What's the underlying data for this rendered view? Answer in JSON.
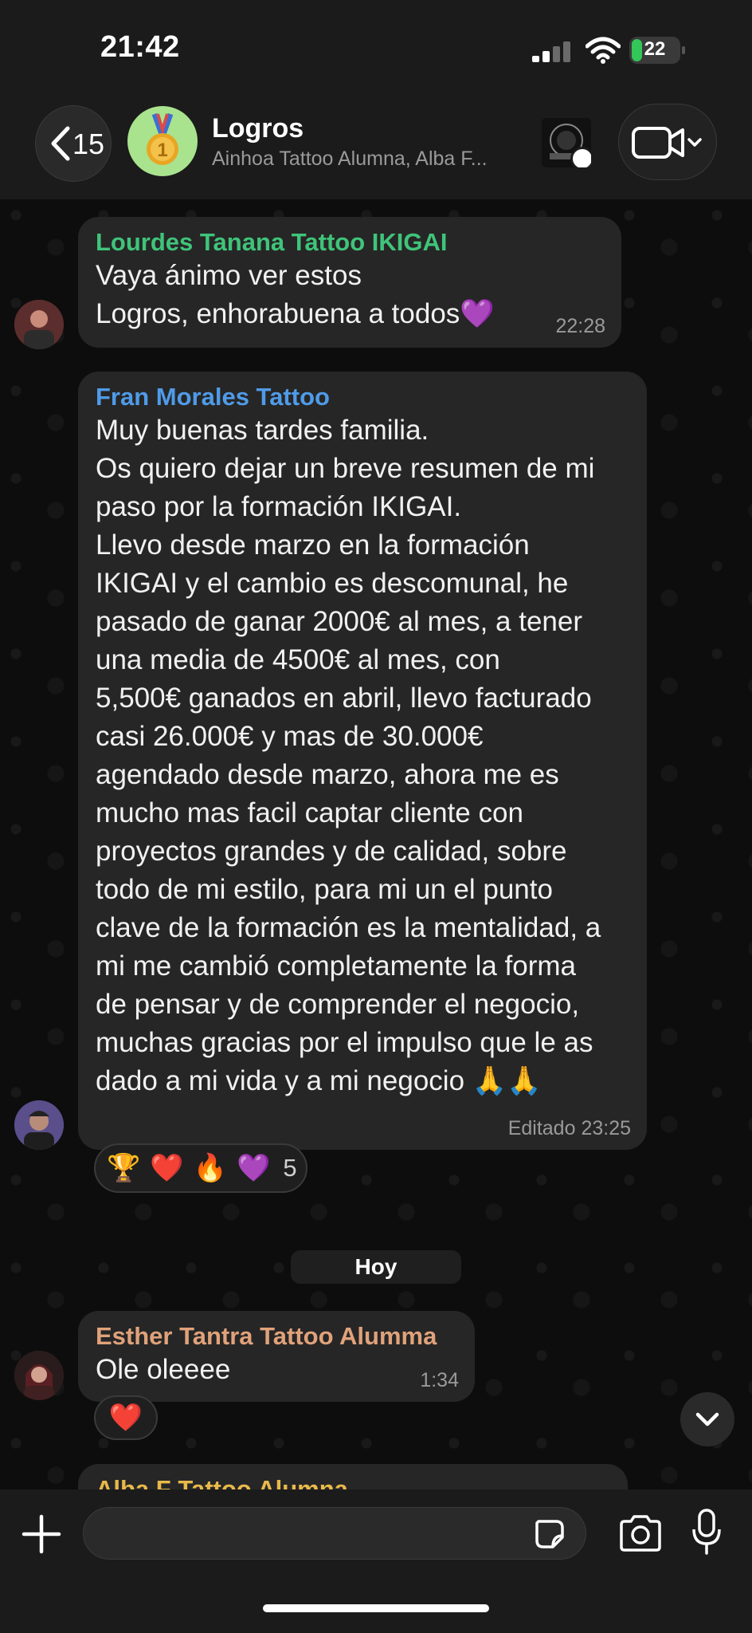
{
  "status_bar": {
    "time": "21:42",
    "battery": "22",
    "battery_level": 0.22
  },
  "header": {
    "back_count": "15",
    "title": "Logros",
    "subtitle": "Ainhoa Tattoo Alumna, Alba F..."
  },
  "messages": [
    {
      "sender": "Lourdes Tanana Tattoo IKIGAI",
      "sender_color": "#3fc47a",
      "text": "Vaya ánimo ver estos\nLogros, enhorabuena a todos💜",
      "time": "22:28"
    },
    {
      "sender": "Fran Morales Tattoo",
      "sender_color": "#4f9be8",
      "text": "Muy buenas tardes familia.\nOs quiero dejar un breve resumen de mi\npaso por la formación IKIGAI.\nLlevo desde marzo en la formación\nIKIGAI y el cambio es descomunal, he\npasado de ganar 2000€ al mes, a tener\nuna media de 4500€ al mes, con\n5,500€ ganados en abril, llevo facturado\ncasi 26.000€ y mas de 30.000€\nagendado desde marzo, ahora me es\nmucho mas facil captar cliente con\nproyectos grandes y de calidad, sobre\ntodo de mi estilo, para mi un el punto\nclave de la formación es la mentalidad, a\nmi me cambió completamente la forma\nde pensar y de comprender el negocio,\nmuchas gracias por el impulso que le as\ndado a mi vida y a mi negocio 🙏🙏",
      "time": "Editado 23:25",
      "reactions": [
        "🏆",
        "❤️",
        "🔥",
        "💜"
      ],
      "reaction_count": "5"
    },
    {
      "sender": "Esther Tantra Tattoo Alumma",
      "sender_color": "#e0a27a",
      "text": "Ole oleeee",
      "time": "1:34",
      "reactions": [
        "❤️"
      ]
    },
    {
      "sender": "Alba F Tattoo Alumna",
      "sender_color": "#e8b94a"
    }
  ],
  "day_separator": "Hoy",
  "input": {
    "placeholder": ""
  }
}
